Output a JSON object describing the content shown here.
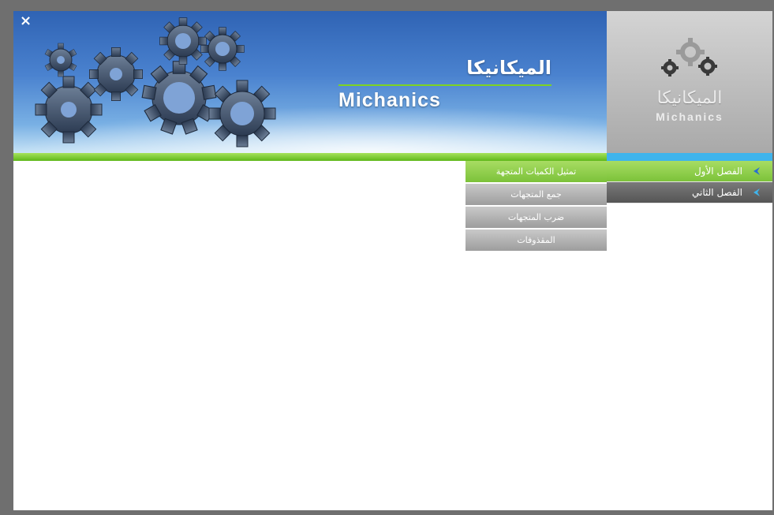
{
  "window": {
    "close_symbol": "×"
  },
  "banner": {
    "title_ar": "الميكانيكا",
    "title_en": "Michanics",
    "decoration": "gears-icon"
  },
  "logo": {
    "title_ar": "الميكانيكا",
    "title_en": "Michanics",
    "icon": "gears-icon"
  },
  "menu": {
    "items": [
      {
        "label": "الفصل الأول",
        "state": "active",
        "icon": "arrow-icon"
      },
      {
        "label": "الفصل الثاني",
        "state": "inactive",
        "icon": "arrow-icon"
      }
    ]
  },
  "submenu": {
    "items": [
      {
        "label": "تمثيل الكميات المتجهة",
        "state": "active"
      },
      {
        "label": "جمع المتجهات",
        "state": "normal"
      },
      {
        "label": "ضرب المتجهات",
        "state": "normal"
      },
      {
        "label": "المقذوفات",
        "state": "normal"
      }
    ]
  },
  "colors": {
    "accent_green": "#7cc23a",
    "accent_blue": "#3fb4ec",
    "banner_blue": "#2f63b4",
    "frame_gray": "#6f6f6f"
  }
}
